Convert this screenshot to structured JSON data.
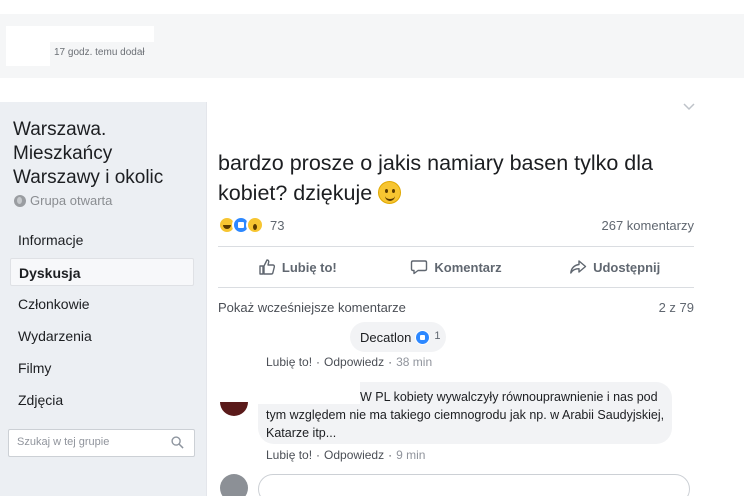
{
  "top": {
    "posted": "17 godz. temu dodał"
  },
  "group": {
    "title": "Warszawa. Mieszkańcy Warszawy i okolic",
    "type": "Grupa otwarta",
    "nav": [
      "Informacje",
      "Dyskusja",
      "Członkowie",
      "Wydarzenia",
      "Filmy",
      "Zdjęcia"
    ],
    "active_nav": "Dyskusja",
    "search_placeholder": "Szukaj w tej grupie"
  },
  "post": {
    "text": "bardzo prosze o jakis namiary basen tylko dla kobiet? dziękuje",
    "reaction_count": "73",
    "comment_count": "267 komentarzy",
    "actions": {
      "like": "Lubię to!",
      "comment": "Komentarz",
      "share": "Udostępnij"
    }
  },
  "comments": {
    "older_label": "Pokaż wcześniejsze komentarze",
    "pager": "2 z 79",
    "items": [
      {
        "text": "Decatlon",
        "likes": "1",
        "like_label": "Lubię to!",
        "reply_label": "Odpowiedz",
        "time": "38 min"
      },
      {
        "text": "W PL kobiety wywalczyły równouprawnienie i nas pod tym względem nie ma takiego ciemnogrodu jak np. w Arabii Saudyjskiej, Katarze itp...",
        "like_label": "Lubię to!",
        "reply_label": "Odpowiedz",
        "time": "9 min"
      }
    ]
  },
  "colors": {
    "sidebar_bg": "#eceff3",
    "like_blue": "#2d88ff",
    "text_gray": "#606770"
  }
}
